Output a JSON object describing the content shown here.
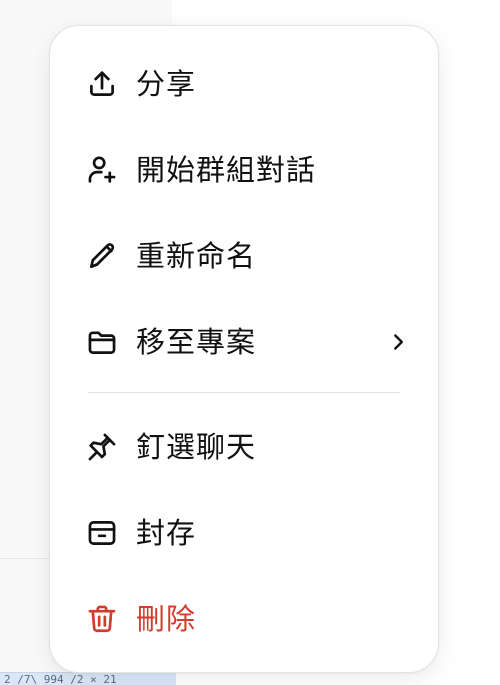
{
  "background": {
    "status_text": "2 /7\\ 994 /2 × 21"
  },
  "menu": {
    "items": [
      {
        "label": "分享",
        "icon": "share-icon"
      },
      {
        "label": "開始群組對話",
        "icon": "add-user-icon"
      },
      {
        "label": "重新命名",
        "icon": "pencil-icon"
      },
      {
        "label": "移至專案",
        "icon": "folder-icon",
        "submenu": true
      },
      {
        "label": "釘選聊天",
        "icon": "pin-icon"
      },
      {
        "label": "封存",
        "icon": "archive-icon"
      },
      {
        "label": "刪除",
        "icon": "trash-icon",
        "danger": true
      }
    ]
  },
  "colors": {
    "text": "#111111",
    "danger": "#d33b2c",
    "divider": "#e1e1e1"
  }
}
